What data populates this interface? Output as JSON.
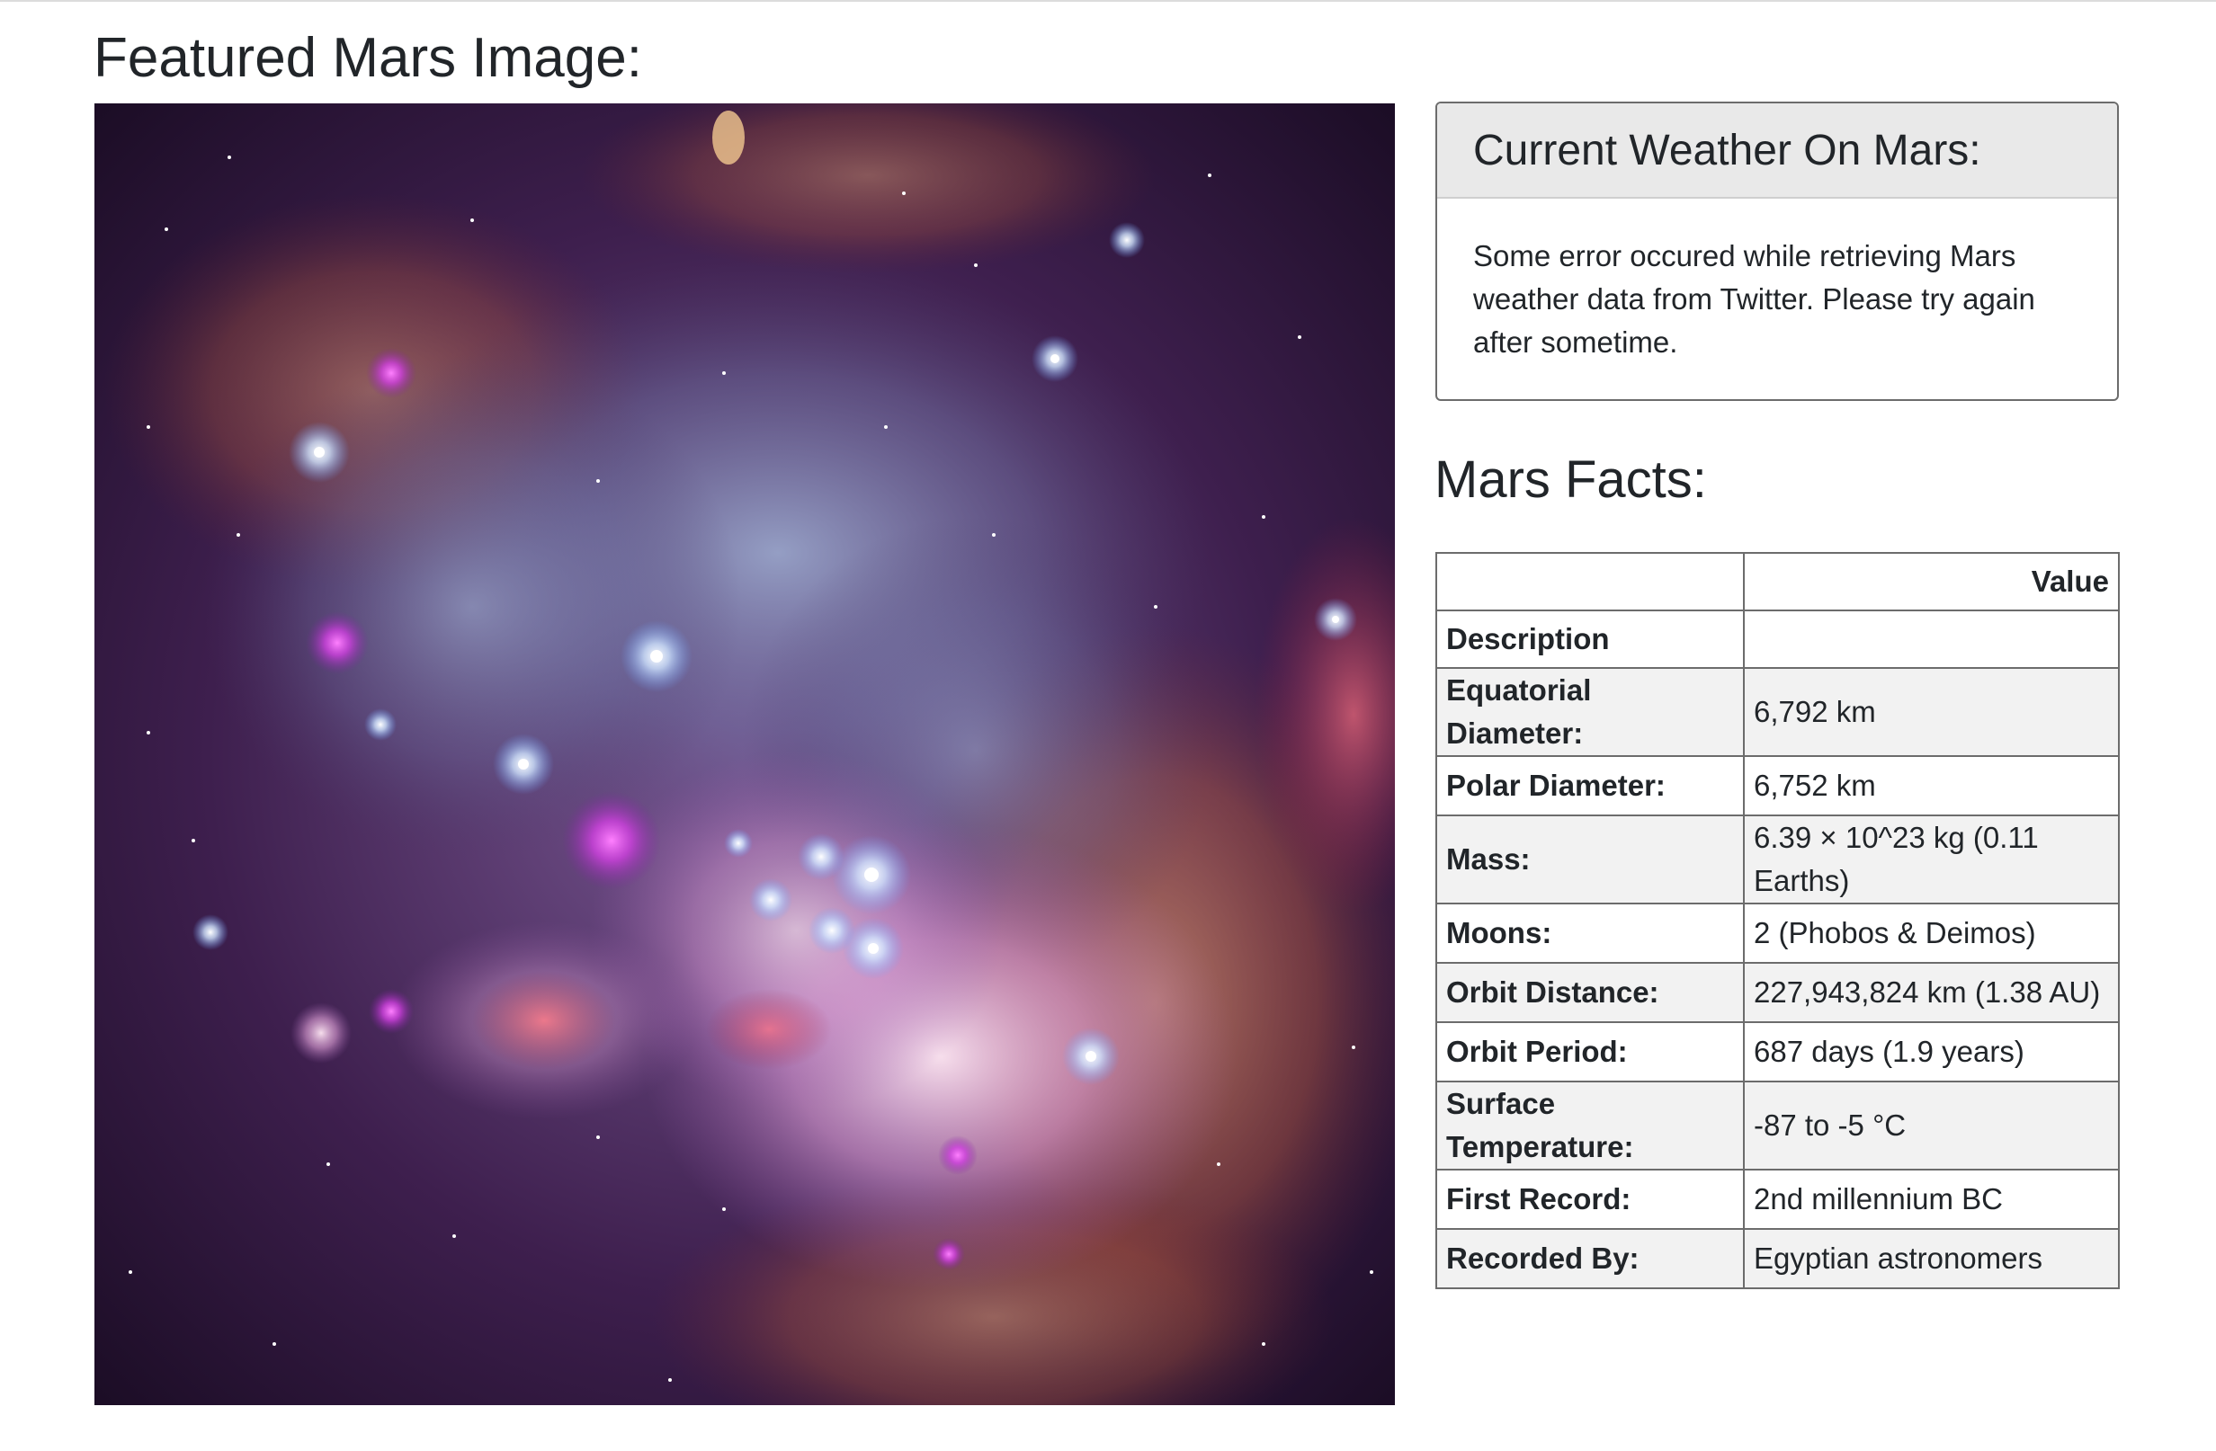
{
  "featured": {
    "title": "Featured Mars Image:",
    "image_alt": "Featured Mars image: nebula with bright star cluster"
  },
  "weather": {
    "title": "Current Weather On Mars:",
    "message": "Some error occured while retrieving Mars weather data from Twitter. Please try again after sometime."
  },
  "facts": {
    "title": "Mars Facts:",
    "column_header": "Value",
    "index_label": "Description",
    "rows": [
      {
        "label": "Equatorial Diameter:",
        "value": "6,792 km"
      },
      {
        "label": "Polar Diameter:",
        "value": "6,752 km"
      },
      {
        "label": "Mass:",
        "value": "6.39 × 10^23 kg (0.11 Earths)"
      },
      {
        "label": "Moons:",
        "value": "2 (Phobos & Deimos)"
      },
      {
        "label": "Orbit Distance:",
        "value": "227,943,824 km (1.38 AU)"
      },
      {
        "label": "Orbit Period:",
        "value": "687 days (1.9 years)"
      },
      {
        "label": "Surface Temperature:",
        "value": "-87 to -5 °C"
      },
      {
        "label": "First Record:",
        "value": "2nd millennium BC"
      },
      {
        "label": "Recorded By:",
        "value": "Egyptian astronomers"
      }
    ]
  }
}
